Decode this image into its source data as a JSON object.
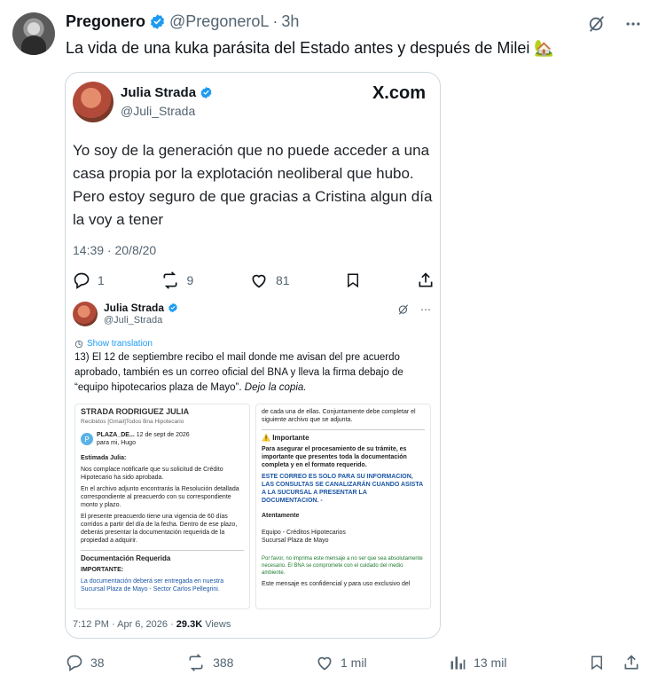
{
  "post": {
    "author_name": "Pregonero",
    "handle": "@PregoneroL",
    "separator": "·",
    "time": "3h",
    "text": "La vida de una kuka parásita del Estado antes y después de Milei 🏡"
  },
  "card": {
    "source": "X.com",
    "quote": {
      "author_name": "Julia Strada",
      "handle": "@Juli_Strada",
      "text": "Yo soy de la generación que no puede acceder a una casa propia por la explotación neoliberal que hubo. Pero estoy seguro de que gracias a Cristina algun día la voy a tener",
      "date": "14:39 · 20/8/20",
      "replies": "1",
      "reposts": "9",
      "likes": "81"
    },
    "inner_post": {
      "author_name": "Julia Strada",
      "handle": "@Juli_Strada",
      "show_translation": "Show translation",
      "text_main": "13) El 12 de septiembre recibo el mail donde me avisan del pre acuerdo aprobado, también es un correo oficial del BNA y lleva la firma debajo de “equipo hipotecarios plaza de Mayo”.",
      "text_italic": "Dejo la copia.",
      "email_left": {
        "subject": "STRADA RODRIGUEZ JULIA",
        "tags": "Recibidos  [Gmail]Todos  Bna Hipotecario",
        "sender": "PLAZA_DE...",
        "sent_date": "12 de sept de 2026",
        "to": "para mi, Hugo",
        "greeting": "Estimada Julia:",
        "p1": "Nos complace notificarle que su solicitud de Crédito Hipotecario ha sido aprobada.",
        "p2": "En el archivo adjunto encontrarás la Resolución detallada correspondiente al preacuerdo con su correspondiente monto y plazo.",
        "p3": "El presente preacuerdo tiene una vigencia de 60 días corridos a partir del día de la fecha. Dentro de ese plazo, deberás presentar la documentación requerida de la propiedad a adquirir.",
        "section": "Documentación Requerida",
        "important": "IMPORTANTE:",
        "p4": "La documentación deberá ser entregada en nuestra Sucursal Plaza de Mayo - Sector Carlos Pellegrini."
      },
      "email_right": {
        "p1": "de cada una de ellas. Conjuntamente debe completar el siguiente archivo que se adjunta.",
        "important_title": "Importante",
        "p2": "Para asegurar el procesamiento de su trámite, es importante que presentes toda la documentación completa y en el formato requerido.",
        "notice": "ESTE CORREO ES SOLO PARA SU INFORMACION, LAS CONSULTAS SE CANALIZARÁN CUANDO ASISTA A LA SUCURSAL A PRESENTAR LA DOCUMENTACION. -",
        "regards": "Atentamente",
        "sig1": "Equipo - Créditos Hipotecarios",
        "sig2": "Sucursal Plaza de Mayo",
        "footer1": "Por favor, no imprima este mensaje a no ser que sea absolutamente necesario. El BNA se compromete con el cuidado del medio ambiente.",
        "footer2": "Este mensaje es confidencial y para uso exclusivo del"
      },
      "timestamp": "7:12 PM · Apr 6, 2026 ·",
      "views_count": "29.3K",
      "views_label": "Views"
    }
  },
  "actions": {
    "replies": "38",
    "reposts": "388",
    "likes": "1 mil",
    "views": "13 mil"
  },
  "colors": {
    "accent": "#1d9bf0",
    "muted": "#536471",
    "border": "#cfd9de"
  }
}
